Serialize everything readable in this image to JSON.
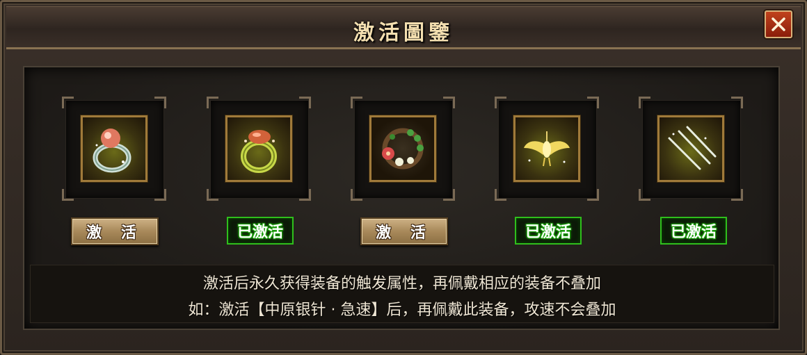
{
  "window": {
    "title": "激活圖鑒",
    "close_icon": "close-x-icon"
  },
  "slots": [
    {
      "icon": "ring-pink-gem-icon",
      "button_label": "激 活",
      "activated": false
    },
    {
      "icon": "ring-red-gem-icon",
      "button_label": "已激活",
      "activated": true
    },
    {
      "icon": "flower-wreath-icon",
      "button_label": "激 活",
      "activated": false
    },
    {
      "icon": "golden-wing-pendant-icon",
      "button_label": "已激活",
      "activated": true
    },
    {
      "icon": "silver-needles-icon",
      "button_label": "已激活",
      "activated": true
    }
  ],
  "description": {
    "line1": "激活后永久获得装备的触发属性，再佩戴相应的装备不叠加",
    "line2": "如：激活【中原银针 · 急速】后，再佩戴此装备，攻速不会叠加"
  },
  "colors": {
    "title_text": "#f4dfb0",
    "activated_border": "#2fbf1c",
    "activate_button": "#a8895a",
    "close_button": "#b83a18"
  }
}
